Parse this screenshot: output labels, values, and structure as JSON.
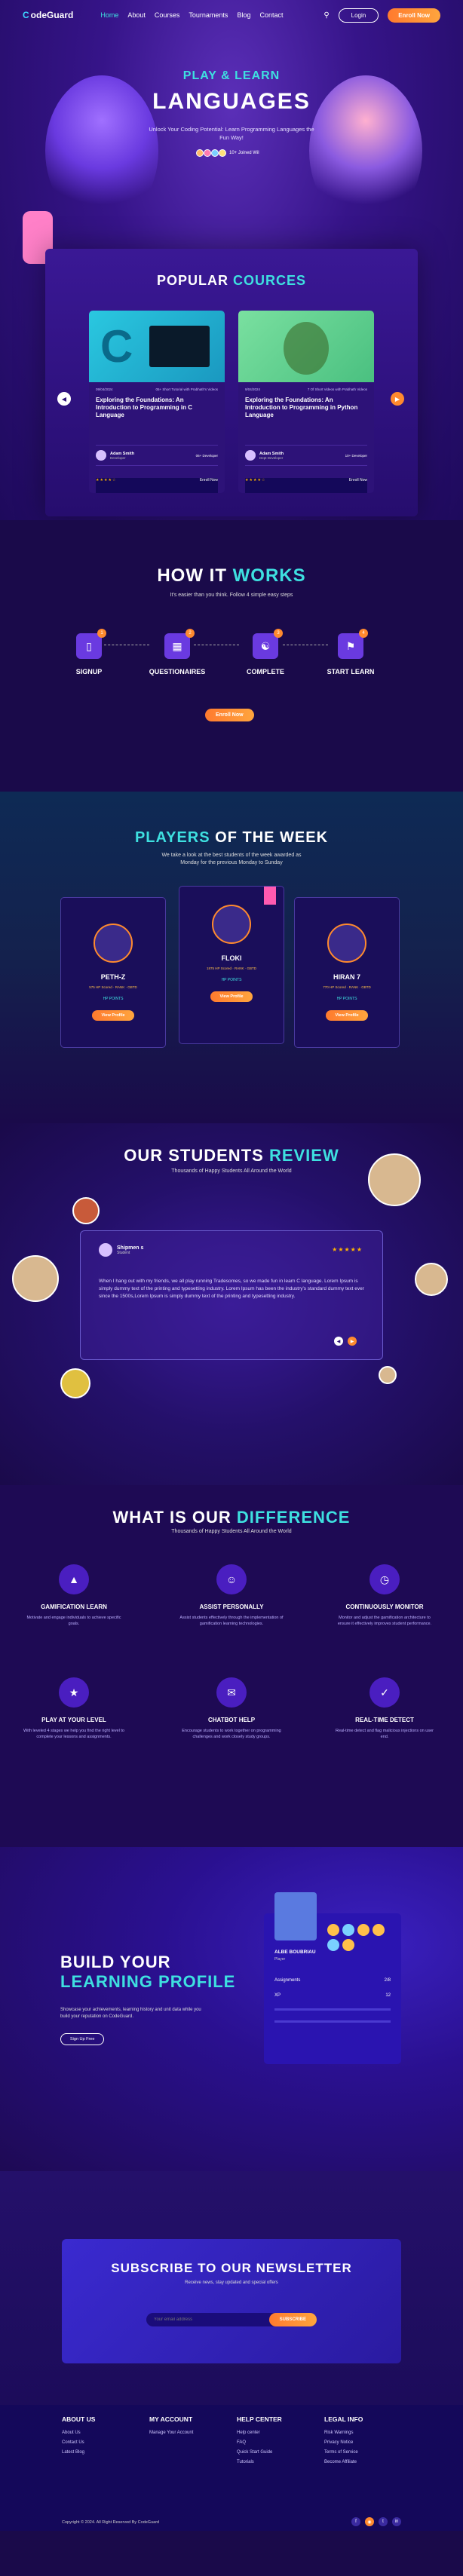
{
  "header": {
    "logo_prefix": "C",
    "logo_text": "odeGuard",
    "nav": [
      "Home",
      "About",
      "Courses",
      "Tournaments",
      "Blog",
      "Contact"
    ],
    "login": "Login",
    "enroll": "Enroll Now"
  },
  "hero": {
    "subtitle": "PLAY & LEARN",
    "title": "LANGUAGES",
    "description": "Unlock Your Coding Potential: Learn Programming Languages the Fun Way!",
    "joined": "10+ Joined Wil"
  },
  "courses": {
    "heading_a": "POPULAR",
    "heading_b": "COURCES",
    "items": [
      {
        "date": "09/04/2024",
        "level": "05+ Short Tutorial with Prabhath's Videos",
        "title": "Exploring the Foundations: An Introduction to Programming in C Language",
        "author": "Adam Smith",
        "role": "Developer",
        "lvl": "06+ Developer",
        "enroll": "Enroll Now"
      },
      {
        "date": "9/04/2024",
        "level": "7 Of Short Videos with Prabhath Videos",
        "title": "Exploring the Foundations: An Introduction to Programming in Python Language",
        "author": "Adam Smith",
        "role": "Dept Developer",
        "lvl": "10+ Developer",
        "enroll": "Enroll Now"
      }
    ]
  },
  "how": {
    "heading_a": "HOW IT",
    "heading_b": "WORKS",
    "tagline": "It's easier than you think. Follow 4 simple easy steps",
    "steps": [
      {
        "num": "1",
        "label": "SIGNUP"
      },
      {
        "num": "2",
        "label": "QUESTIONAIRES"
      },
      {
        "num": "3",
        "label": "COMPLETE"
      },
      {
        "num": "4",
        "label": "START LEARN"
      }
    ],
    "cta": "Enroll Now"
  },
  "players": {
    "heading_a": "PLAYERS",
    "heading_b": "OF THE WEEK",
    "tagline": "We take a look at the best students of the week awarded as Monday for the previous Monday to Sunday",
    "items": [
      {
        "name": "PETH-Z",
        "stats": "575 HP Scored · RANK · GBTD",
        "badge": "HP POINTS",
        "cta": "View Profile"
      },
      {
        "name": "FLOKI",
        "stats": "1875 HP Scored · RANK · GBTD",
        "badge": "HP POINTS",
        "cta": "View Profile"
      },
      {
        "name": "HIRAN 7",
        "stats": "770 HP Scored · RANK · GBTD",
        "badge": "HP POINTS",
        "cta": "View Profile"
      }
    ]
  },
  "review": {
    "heading_a": "OUR STUDENTS",
    "heading_b": "REVIEW",
    "tagline": "Thousands of Happy Students All Around the World",
    "name": "Shipmen s",
    "role": "Student",
    "text": "When I hang out with my friends, we all play running Tradesomes, so we made fun in learn C language. Lorem Ipsum is simply dummy text of the printing and typesetting industry. Lorem Ipsum has been the industry's standard dummy text ever since the 1500s,Lorem Ipsum is simply dummy text of the printing and typesetting industry."
  },
  "difference": {
    "heading_a": "WHAT IS OUR",
    "heading_b": "DIFFERENCE",
    "tagline": "Thousands of Happy Students All Around the World",
    "items": [
      {
        "label": "GAMIFICATION LEARN",
        "desc": "Motivate and engage individuals to achieve specific goals."
      },
      {
        "label": "ASSIST PERSONALLY",
        "desc": "Assist students effectively through the implementation of gamification learning technologies."
      },
      {
        "label": "CONTINUOUSLY MONITOR",
        "desc": "Monitor and adjust the gamification architecture to ensure it effectively improves student performance."
      },
      {
        "label": "PLAY AT YOUR LEVEL",
        "desc": "With leveled 4 stages we help you find the right level to complete your lessons and assignments."
      },
      {
        "label": "CHATBOT HELP",
        "desc": "Encourage students to work together on programming challenges and work closely study groups."
      },
      {
        "label": "REAL-TIME DETECT",
        "desc": "Real-time detect and flag malicious injections on user end."
      }
    ]
  },
  "profile": {
    "heading_a": "BUILD YOUR",
    "heading_b": "LEARNING",
    "heading_c": "PROFILE",
    "desc": "Showcase your achievements, learning history and unit data while you build your reputation on CodeGuard.",
    "signup": "Sign Up Free",
    "user": "ALBE BOUBRIAU",
    "role": "Player",
    "rows": [
      {
        "label": "Assignments",
        "value": "2/8"
      },
      {
        "label": "XP",
        "value": "12"
      }
    ]
  },
  "newsletter": {
    "title": "SUBSCRIBE TO OUR NEWSLETTER",
    "desc": "Receive news, stay updated and special offers",
    "placeholder": "Your email address",
    "button": "SUBSCRIBE"
  },
  "footer": {
    "cols": [
      {
        "title": "ABOUT US",
        "items": [
          "About Us",
          "Contact Us",
          "Latest Blog"
        ]
      },
      {
        "title": "MY ACCOUNT",
        "items": [
          "Manage Your Account"
        ]
      },
      {
        "title": "HELP CENTER",
        "items": [
          "Help center",
          "FAQ",
          "Quick Start Guide",
          "Tutorials"
        ]
      },
      {
        "title": "LEGAL INFO",
        "items": [
          "Risk Warnings",
          "Privacy Notice",
          "Terms of Service",
          "Become Affiliate"
        ]
      }
    ],
    "copyright": "Copyright © 2024. All Right Reserved By CodeGuard"
  },
  "colors": {
    "accent": "#3ee0e0",
    "orange": "#ff8a2e",
    "bg": "#1a0a4a"
  }
}
